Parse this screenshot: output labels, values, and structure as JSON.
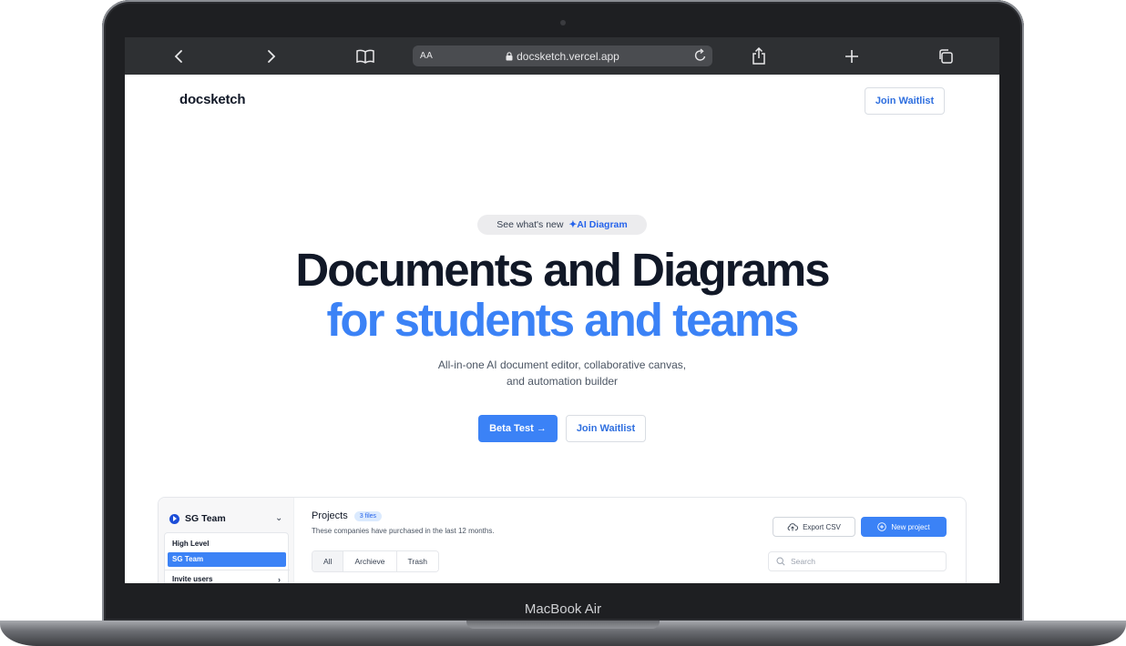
{
  "device": {
    "label": "MacBook Air"
  },
  "browser": {
    "aa": "AA",
    "url": "docsketch.vercel.app"
  },
  "site": {
    "logo": "docsketch",
    "header_button": "Join Waitlist",
    "pill_prefix": "See what's new",
    "pill_highlight": "AI Diagram",
    "headline_line1": "Documents and Diagrams",
    "headline_line2": "for students and teams",
    "subtitle_line1": "All-in-one AI document editor, collaborative canvas,",
    "subtitle_line2": "and automation builder",
    "primary_cta": "Beta Test →",
    "secondary_cta": "Join Waitlist"
  },
  "preview": {
    "team_name": "SG Team",
    "dropdown_items": [
      "High Level",
      "SG Team"
    ],
    "invite_label": "Invite users",
    "title": "Projects",
    "files_badge": "3 files",
    "description": "These companies have purchased in the last 12 months.",
    "export_label": "Export CSV",
    "new_project_label": "New project",
    "tabs": [
      "All",
      "Archieve",
      "Trash"
    ],
    "search_placeholder": "Search"
  },
  "colors": {
    "accent": "#3b82f6",
    "text": "#111827",
    "browser_bar": "#2e3033"
  }
}
